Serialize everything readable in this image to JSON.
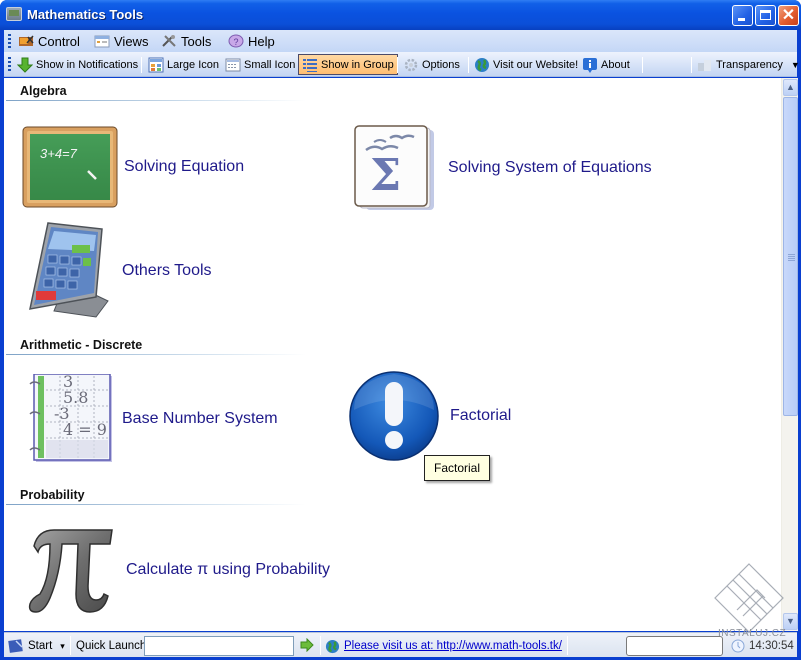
{
  "window": {
    "title": "Mathematics Tools",
    "controls": {
      "minimize": "_",
      "maximize": "□",
      "close": "✕"
    }
  },
  "menubar": {
    "items": [
      {
        "label": "Control",
        "icon": "control-icon"
      },
      {
        "label": "Views",
        "icon": "views-icon"
      },
      {
        "label": "Tools",
        "icon": "tools-icon"
      },
      {
        "label": "Help",
        "icon": "help-icon"
      }
    ]
  },
  "toolbar": {
    "items": [
      {
        "label": "Show in Notifications",
        "icon": "download-arrow-icon",
        "active": false
      },
      {
        "label": "Large Icon",
        "icon": "large-icon-view-icon",
        "active": false
      },
      {
        "label": "Small Icon",
        "icon": "small-icon-view-icon",
        "active": false
      },
      {
        "label": "Show in Group",
        "icon": "group-view-icon",
        "active": true
      },
      {
        "label": "Options",
        "icon": "gear-icon",
        "active": false
      },
      {
        "label": "Visit our Website!",
        "icon": "globe-icon",
        "active": false
      },
      {
        "label": "About",
        "icon": "info-icon",
        "active": false
      },
      {
        "label": "Transparency",
        "icon": "transparency-icon",
        "active": false,
        "dropdown": true
      }
    ]
  },
  "groups": [
    {
      "title": "Algebra",
      "tools": [
        {
          "label": "Solving Equation",
          "icon": "chalkboard-icon",
          "board_text": "3+4=7"
        },
        {
          "label": "Solving System of Equations",
          "icon": "sigma-document-icon",
          "symbol": "Σ"
        },
        {
          "label": "Others Tools",
          "icon": "calculator-icon"
        }
      ]
    },
    {
      "title": "Arithmetic - Discrete",
      "tools": [
        {
          "label": "Base Number System",
          "icon": "notebook-numbers-icon",
          "lines": [
            "3",
            "5.8",
            "-3",
            "4 = 9"
          ]
        },
        {
          "label": "Factorial",
          "icon": "exclamation-icon",
          "symbol": "!"
        }
      ]
    },
    {
      "title": "Probability",
      "tools": [
        {
          "label": "Calculate π using Probability",
          "icon": "pi-icon",
          "symbol": "π"
        }
      ]
    }
  ],
  "tooltip": {
    "text": "Factorial"
  },
  "scrollbar": {
    "up": "▲",
    "down": "▼",
    "visible_fraction": 0.62,
    "position_fraction": 0.0
  },
  "statusbar": {
    "start_label": "Start",
    "start_dropdown": "▾",
    "quick_launch_label": "Quick Launch",
    "quick_launch_value": "",
    "go_icon": "go-arrow-icon",
    "link_text": "Please visit us at: http://www.math-tools.tk/",
    "status_field_value": "",
    "clock": "14:30:54"
  },
  "watermark": {
    "text": "INSTALUJ.CZ"
  }
}
